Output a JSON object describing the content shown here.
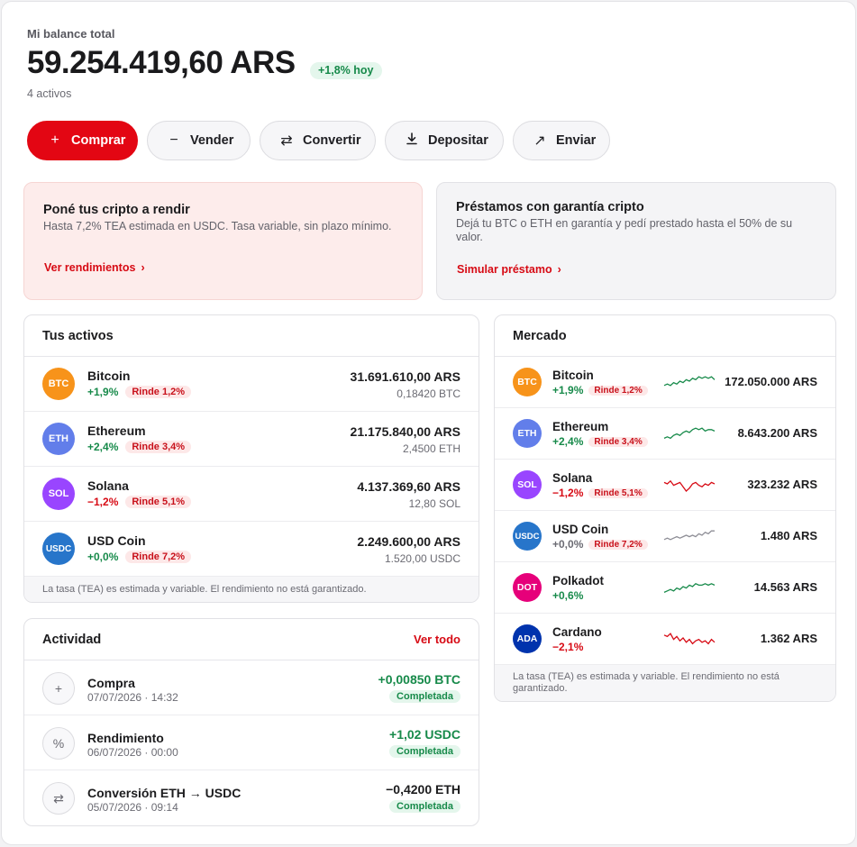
{
  "balance": {
    "label": "Mi balance total",
    "amount": "59.254.419,60 ARS",
    "change": "+1,8% hoy",
    "assets_count": "4 activos"
  },
  "actions": {
    "buy": "Comprar",
    "sell": "Vender",
    "convert": "Convertir",
    "deposit": "Depositar",
    "send": "Enviar"
  },
  "promos": {
    "yield": {
      "title": "Poné tus cripto a rendir",
      "text": "Hasta 7,2% TEA estimada en USDC. Tasa variable, sin plazo mínimo.",
      "link": "Ver rendimientos"
    },
    "loan": {
      "title": "Préstamos con garantía cripto",
      "text": "Dejá tu BTC o ETH en garantía y pedí prestado hasta el 50% de su valor.",
      "link": "Simular préstamo"
    }
  },
  "assets": {
    "title": "Tus activos",
    "items": [
      {
        "symbol": "BTC",
        "name": "Bitcoin",
        "change": "+1,9%",
        "trend": "pos",
        "yield": "Rinde 1,2%",
        "value": "31.691.610,00 ARS",
        "qty": "0,18420 BTC",
        "color": "#f7931a"
      },
      {
        "symbol": "ETH",
        "name": "Ethereum",
        "change": "+2,4%",
        "trend": "pos",
        "yield": "Rinde 3,4%",
        "value": "21.175.840,00 ARS",
        "qty": "2,4500 ETH",
        "color": "#627eea"
      },
      {
        "symbol": "SOL",
        "name": "Solana",
        "change": "−1,2%",
        "trend": "neg",
        "yield": "Rinde 5,1%",
        "value": "4.137.369,60 ARS",
        "qty": "12,80 SOL",
        "color": "#9945ff"
      },
      {
        "symbol": "USDC",
        "name": "USD Coin",
        "change": "+0,0%",
        "trend": "pos",
        "yield": "Rinde 7,2%",
        "value": "2.249.600,00 ARS",
        "qty": "1.520,00 USDC",
        "color": "#2775ca"
      }
    ],
    "footnote": "La tasa (TEA) es estimada y variable. El rendimiento no está garantizado."
  },
  "activity": {
    "title": "Actividad",
    "see_all": "Ver todo",
    "items": [
      {
        "icon": "plus-icon",
        "glyph": "+",
        "title": "Compra",
        "date": "07/07/2026 · 14:32",
        "amount": "+0,00850 BTC",
        "trend": "pos",
        "status": "Completada"
      },
      {
        "icon": "percent-icon",
        "glyph": "%",
        "title": "Rendimiento",
        "date": "06/07/2026 · 00:00",
        "amount": "+1,02 USDC",
        "trend": "pos",
        "status": "Completada"
      },
      {
        "icon": "convert-icon",
        "glyph": "⇄",
        "title": "Conversión ETH → USDC",
        "date": "05/07/2026 · 09:14",
        "amount": "−0,4200 ETH",
        "trend": "dark",
        "status": "Completada"
      }
    ]
  },
  "market": {
    "title": "Mercado",
    "items": [
      {
        "symbol": "BTC",
        "name": "Bitcoin",
        "change": "+1,9%",
        "trend": "pos",
        "yield": "Rinde 1,2%",
        "price": "172.050.000 ARS",
        "color": "#f7931a",
        "spark_color": "#178a4a"
      },
      {
        "symbol": "ETH",
        "name": "Ethereum",
        "change": "+2,4%",
        "trend": "pos",
        "yield": "Rinde 3,4%",
        "price": "8.643.200 ARS",
        "color": "#627eea",
        "spark_color": "#178a4a"
      },
      {
        "symbol": "SOL",
        "name": "Solana",
        "change": "−1,2%",
        "trend": "neg",
        "yield": "Rinde 5,1%",
        "price": "323.232 ARS",
        "color": "#9945ff",
        "spark_color": "#d70a14"
      },
      {
        "symbol": "USDC",
        "name": "USD Coin",
        "change": "+0,0%",
        "trend": "neu",
        "yield": "Rinde 7,2%",
        "price": "1.480 ARS",
        "color": "#2775ca",
        "spark_color": "#8e8e96"
      },
      {
        "symbol": "DOT",
        "name": "Polkadot",
        "change": "+0,6%",
        "trend": "pos",
        "yield": "",
        "price": "14.563 ARS",
        "color": "#e6007a",
        "spark_color": "#178a4a"
      },
      {
        "symbol": "ADA",
        "name": "Cardano",
        "change": "−2,1%",
        "trend": "neg",
        "yield": "",
        "price": "1.362 ARS",
        "color": "#0033ad",
        "spark_color": "#d70a14"
      }
    ],
    "footnote": "La tasa (TEA) es estimada y variable. El rendimiento no está garantizado."
  }
}
